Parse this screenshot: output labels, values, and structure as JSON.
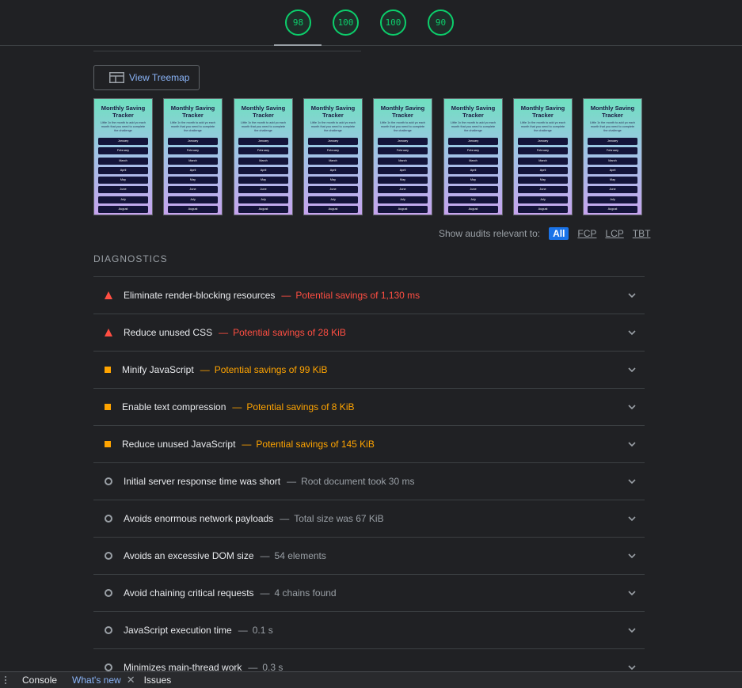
{
  "scores": [
    {
      "label": "98",
      "color": "#0cce6b"
    },
    {
      "label": "100",
      "color": "#0cce6b"
    },
    {
      "label": "100",
      "color": "#0cce6b"
    },
    {
      "label": "90",
      "color": "#0cce6b"
    }
  ],
  "treemap_button": {
    "label": "View Treemap",
    "icon": "treemap-icon"
  },
  "filmstrip": {
    "title": "Monthly Saving Tracker",
    "description": "Little 1x the month to add yo each month that you need to complete the challenge",
    "months": [
      "January",
      "February",
      "March",
      "April",
      "May",
      "June",
      "July",
      "August"
    ],
    "frames": 8
  },
  "filter": {
    "label": "Show audits relevant to:",
    "chips": [
      "All",
      "FCP",
      "LCP",
      "TBT"
    ],
    "active": "All"
  },
  "diagnostics": {
    "heading": "DIAGNOSTICS",
    "audits": [
      {
        "status": "fail",
        "icon": "fail-triangle-icon",
        "title": "Eliminate render-blocking resources",
        "detail": "Potential savings of 1,130 ms"
      },
      {
        "status": "fail",
        "icon": "fail-triangle-icon",
        "title": "Reduce unused CSS",
        "detail": "Potential savings of 28 KiB"
      },
      {
        "status": "avg",
        "icon": "average-square-icon",
        "title": "Minify JavaScript",
        "detail": "Potential savings of 99 KiB"
      },
      {
        "status": "avg",
        "icon": "average-square-icon",
        "title": "Enable text compression",
        "detail": "Potential savings of 8 KiB"
      },
      {
        "status": "avg",
        "icon": "average-square-icon",
        "title": "Reduce unused JavaScript",
        "detail": "Potential savings of 145 KiB"
      },
      {
        "status": "info",
        "icon": "info-circle-icon",
        "title": "Initial server response time was short",
        "detail": "Root document took 30 ms"
      },
      {
        "status": "info",
        "icon": "info-circle-icon",
        "title": "Avoids enormous network payloads",
        "detail": "Total size was 67 KiB"
      },
      {
        "status": "info",
        "icon": "info-circle-icon",
        "title": "Avoids an excessive DOM size",
        "detail": "54 elements"
      },
      {
        "status": "info",
        "icon": "info-circle-icon",
        "title": "Avoid chaining critical requests",
        "detail": "4 chains found"
      },
      {
        "status": "info",
        "icon": "info-circle-icon",
        "title": "JavaScript execution time",
        "detail": "0.1 s"
      },
      {
        "status": "info",
        "icon": "info-circle-icon",
        "title": "Minimizes main-thread work",
        "detail": "0.3 s"
      }
    ],
    "separator": "—"
  },
  "drawer": {
    "tabs": [
      {
        "label": "Console"
      },
      {
        "label": "What's new",
        "selected": true,
        "closable": true
      },
      {
        "label": "Issues"
      }
    ],
    "close_glyph": "✕"
  }
}
